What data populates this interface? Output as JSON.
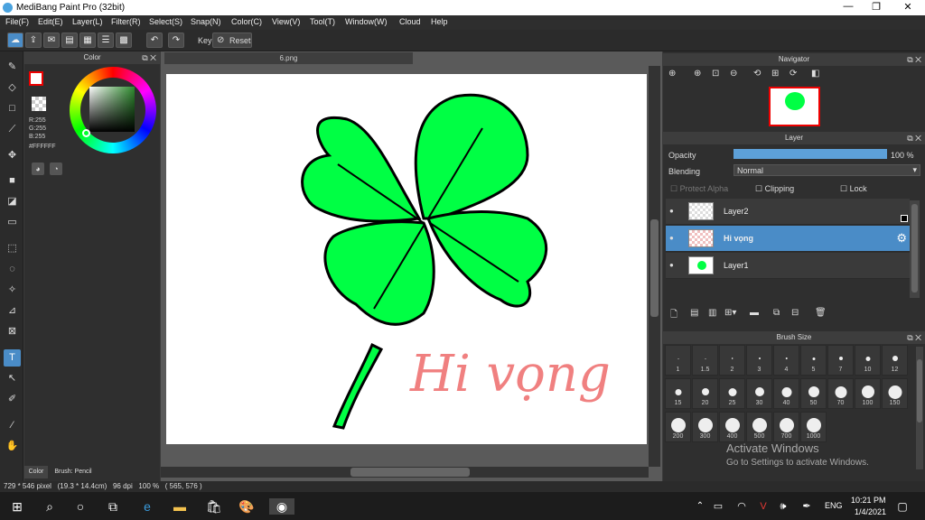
{
  "window": {
    "title": "MediBang Paint Pro (32bit)",
    "minimize": "—",
    "maximize": "❐",
    "close": "✕"
  },
  "menu": [
    "File(F)",
    "Edit(E)",
    "Layer(L)",
    "Filter(R)",
    "Select(S)",
    "Snap(N)",
    "Color(C)",
    "View(V)",
    "Tool(T)",
    "Window(W)",
    "Cloud",
    "Help"
  ],
  "toolbar": {
    "key_label": "Key",
    "reset_label": "Reset"
  },
  "color_panel": {
    "title": "Color",
    "r": "R:255",
    "g": "G:255",
    "b": "B:255",
    "hex": "#FFFFFF",
    "tab_color": "Color",
    "tab_brush": "Brush: Pencil"
  },
  "document": {
    "tab": "6.png",
    "drawing_text": "Hi vọng"
  },
  "navigator": {
    "title": "Navigator"
  },
  "layer_panel": {
    "title": "Layer",
    "opacity_label": "Opacity",
    "opacity_value": "100 %",
    "opacity_fraction": 1.0,
    "blending_label": "Blending",
    "blending_value": "Normal",
    "protect_alpha": "Protect Alpha",
    "clipping": "Clipping",
    "lock": "Lock",
    "layers": [
      {
        "name": "Layer2",
        "selected": false
      },
      {
        "name": "Hi vọng",
        "selected": true
      },
      {
        "name": "Layer1",
        "selected": false
      }
    ]
  },
  "brush_panel": {
    "title": "Brush Size",
    "sizes": [
      "1",
      "1.5",
      "2",
      "3",
      "4",
      "5",
      "7",
      "10",
      "12",
      "15",
      "20",
      "25",
      "30",
      "40",
      "50",
      "70",
      "100",
      "150",
      "200",
      "300",
      "400",
      "500",
      "700",
      "1000"
    ]
  },
  "watermark": {
    "line1": "Activate Windows",
    "line2": "Go to Settings to activate Windows."
  },
  "status": {
    "text": "729 * 546 pixel   (19.3 * 14.4cm)   96 dpi   100 %   ( 565, 576 )"
  },
  "taskbar": {
    "lang": "ENG",
    "time": "10:21 PM",
    "date": "1/4/2021"
  },
  "colors": {
    "accent": "#4a8cc7",
    "clover": "#00ff44",
    "text_pink": "#f08080"
  }
}
